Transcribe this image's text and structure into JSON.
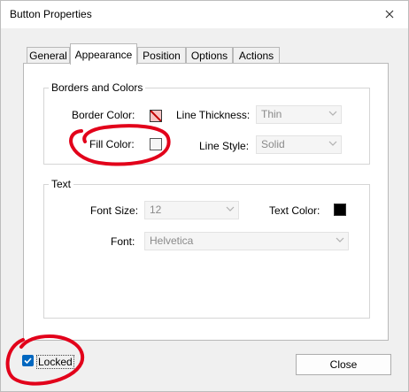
{
  "window": {
    "title": "Button Properties",
    "close_glyph": "×"
  },
  "tabs": [
    {
      "label": "General"
    },
    {
      "label": "Appearance",
      "active": true
    },
    {
      "label": "Position"
    },
    {
      "label": "Options"
    },
    {
      "label": "Actions"
    }
  ],
  "borders_colors": {
    "legend": "Borders and Colors",
    "border_color_label": "Border Color:",
    "fill_color_label": "Fill Color:",
    "line_thickness_label": "Line Thickness:",
    "line_thickness_value": "Thin",
    "line_style_label": "Line Style:",
    "line_style_value": "Solid"
  },
  "text_group": {
    "legend": "Text",
    "font_size_label": "Font Size:",
    "font_size_value": "12",
    "text_color_label": "Text Color:",
    "font_label": "Font:",
    "font_value": "Helvetica"
  },
  "footer": {
    "locked_label": "Locked",
    "locked_checked": true,
    "close_label": "Close"
  },
  "colors": {
    "annotation": "#e2001a",
    "checkbox": "#0067c0",
    "text_color_swatch": "#000000"
  },
  "icons": [
    "close-icon",
    "no-color-swatch-icon",
    "chevron-down-icon",
    "checkmark-icon"
  ]
}
